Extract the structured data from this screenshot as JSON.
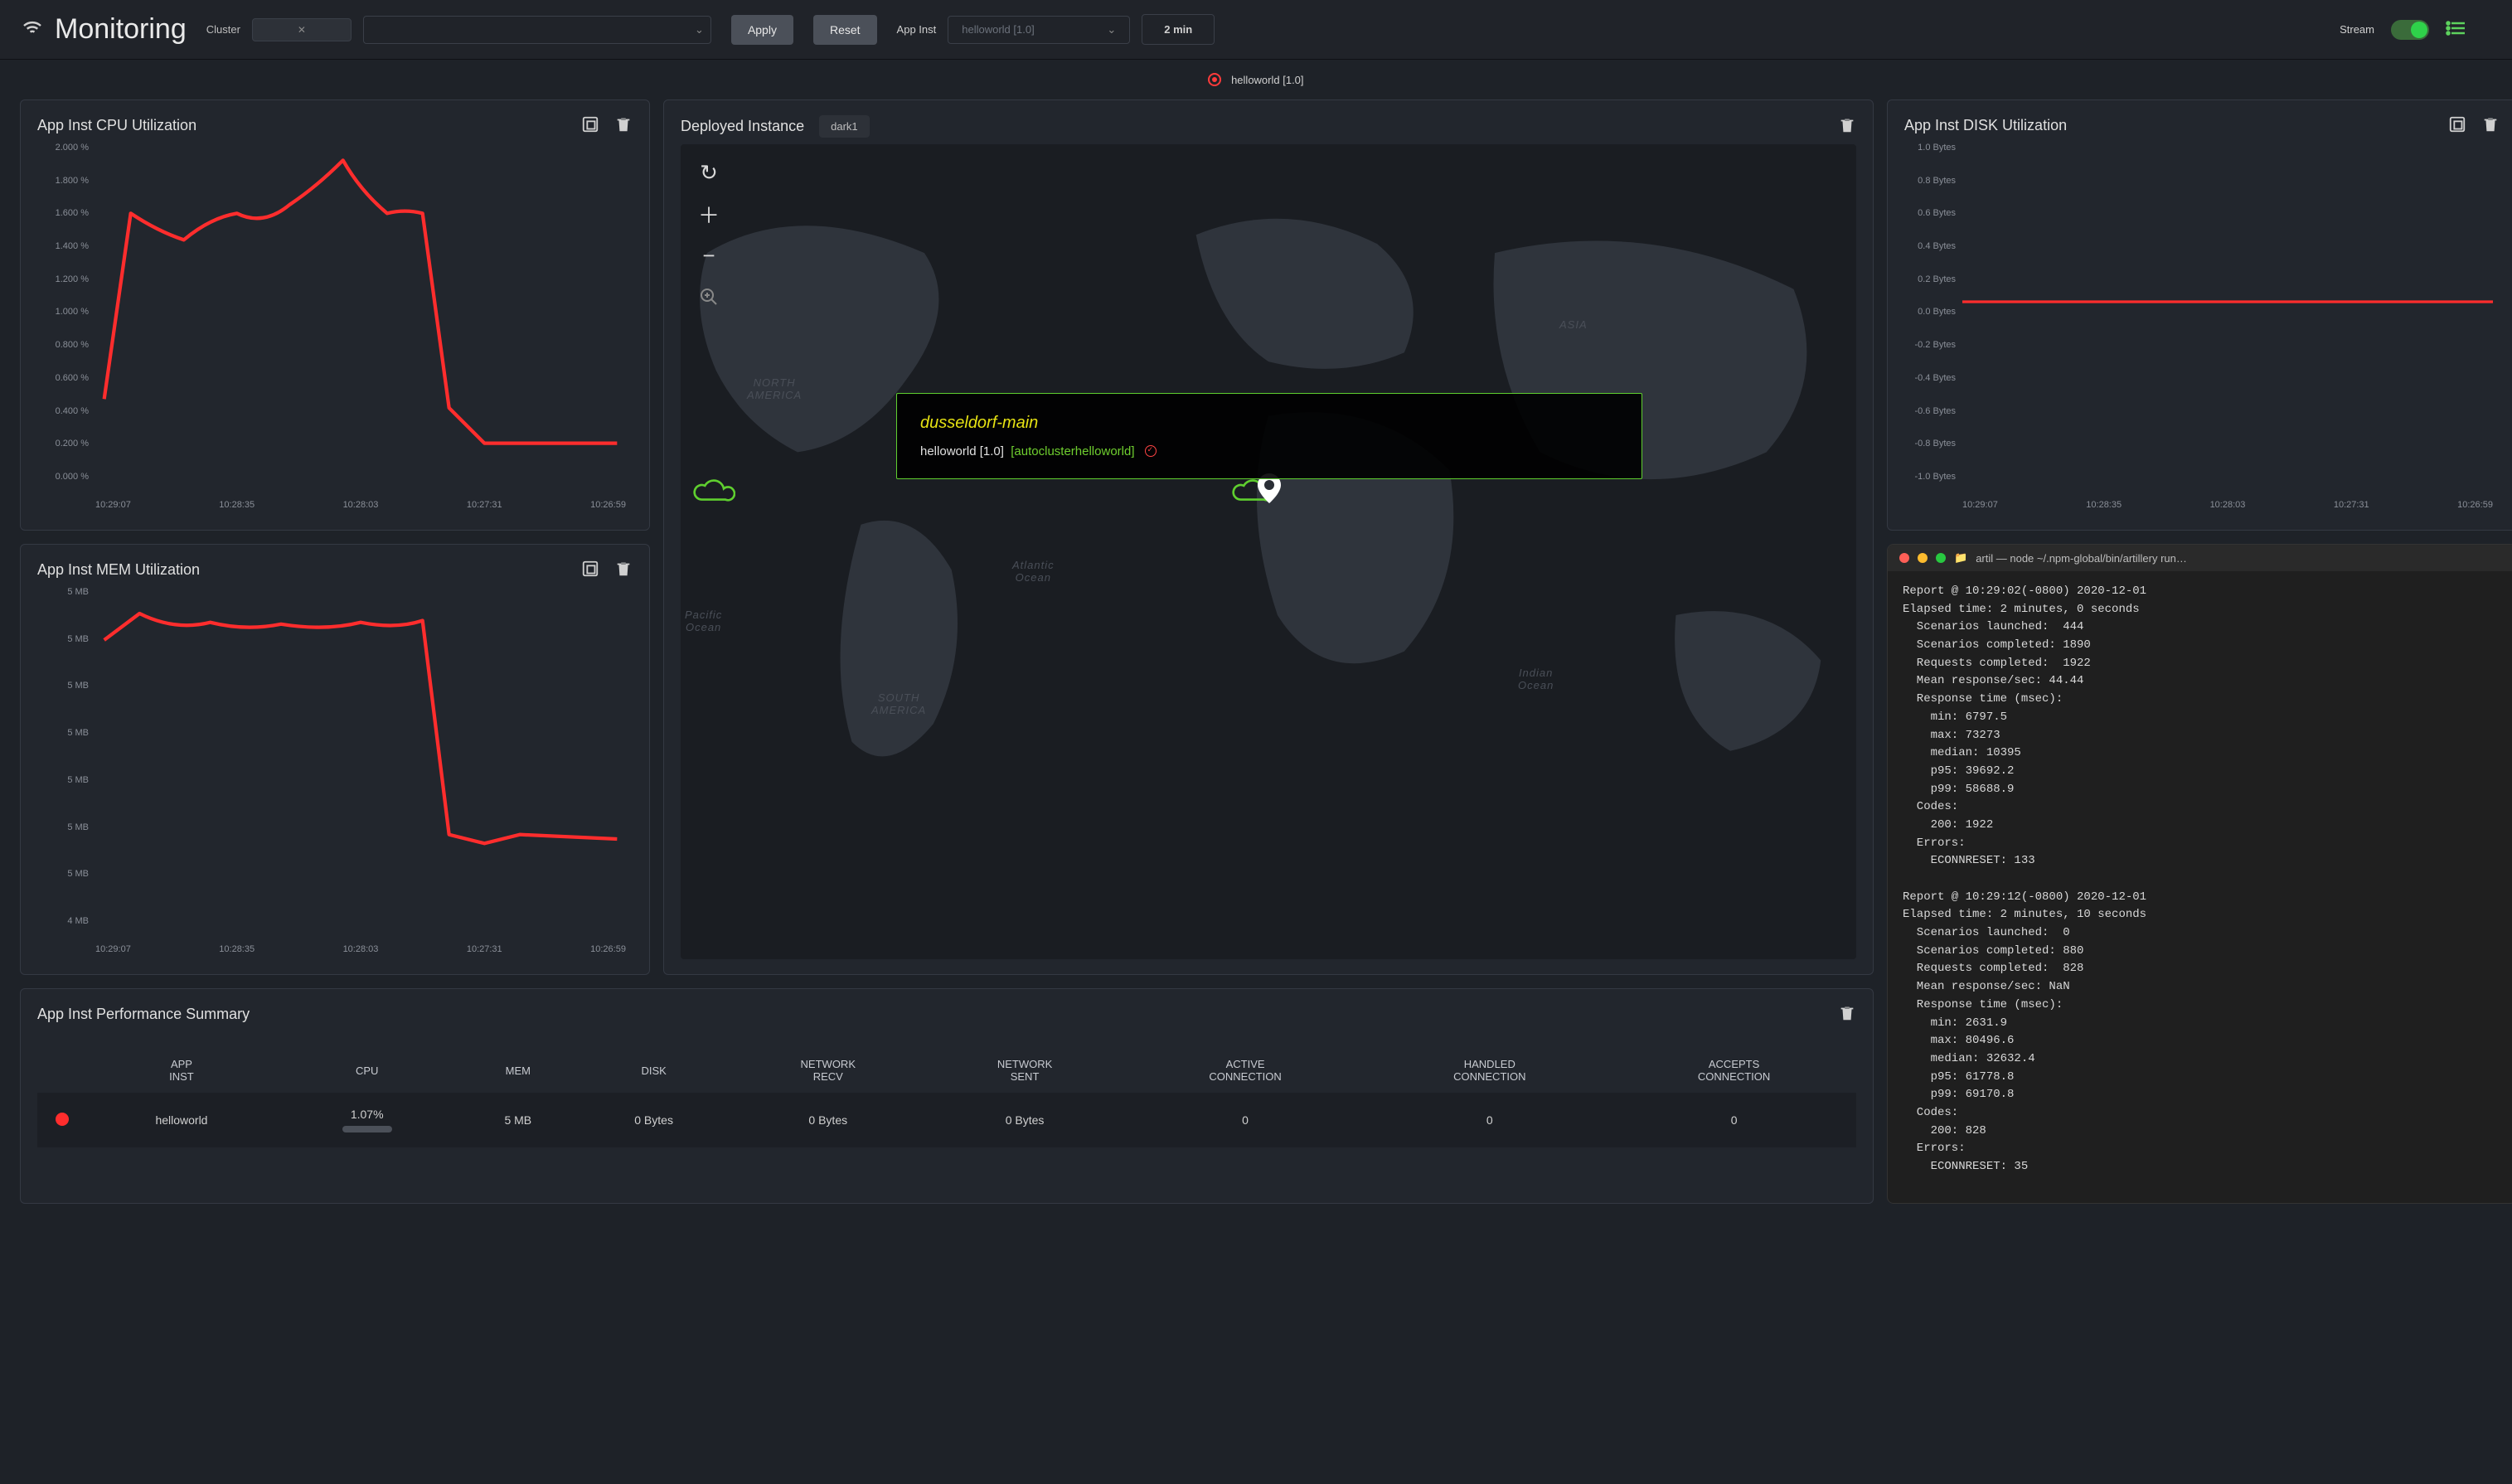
{
  "header": {
    "title": "Monitoring",
    "cluster_label": "Cluster",
    "cluster_value": "",
    "apply_label": "Apply",
    "reset_label": "Reset",
    "appinst_label": "App Inst",
    "appinst_placeholder": "helloworld [1.0]",
    "time_value": "2 min",
    "stream_label": "Stream"
  },
  "status_line": "helloworld [1.0]",
  "panels": {
    "cpu_title": "App Inst CPU Utilization",
    "mem_title": "App Inst MEM Utilization",
    "map_title": "Deployed Instance",
    "map_theme": "dark1",
    "disk_title": "App Inst DISK Utilization",
    "perf_title": "App Inst Performance Summary"
  },
  "map": {
    "tooltip_title": "dusseldorf-main",
    "tooltip_app": "helloworld [1.0]",
    "tooltip_cluster": "[autoclusterhelloworld]",
    "labels": {
      "na": "NORTH\nAMERICA",
      "sa": "SOUTH\nAMERICA",
      "asia": "ASIA",
      "atl": "Atlantic\nOcean",
      "pac": "Pacific\nOcean",
      "ind": "Indian\nOcean"
    }
  },
  "terminal": {
    "title": "artil — node ~/.npm-global/bin/artillery run…",
    "body": "Report @ 10:29:02(-0800) 2020-12-01\nElapsed time: 2 minutes, 0 seconds\n  Scenarios launched:  444\n  Scenarios completed: 1890\n  Requests completed:  1922\n  Mean response/sec: 44.44\n  Response time (msec):\n    min: 6797.5\n    max: 73273\n    median: 10395\n    p95: 39692.2\n    p99: 58688.9\n  Codes:\n    200: 1922\n  Errors:\n    ECONNRESET: 133\n\nReport @ 10:29:12(-0800) 2020-12-01\nElapsed time: 2 minutes, 10 seconds\n  Scenarios launched:  0\n  Scenarios completed: 880\n  Requests completed:  828\n  Mean response/sec: NaN\n  Response time (msec):\n    min: 2631.9\n    max: 80496.6\n    median: 32632.4\n    p95: 61778.8\n    p99: 69170.8\n  Codes:\n    200: 828\n  Errors:\n    ECONNRESET: 35"
  },
  "perf_table": {
    "headers": [
      "APP INST",
      "CPU",
      "MEM",
      "DISK",
      "NETWORK RECV",
      "NETWORK SENT",
      "ACTIVE CONNECTION",
      "HANDLED CONNECTION",
      "ACCEPTS CONNECTION"
    ],
    "row": {
      "app": "helloworld",
      "cpu": "1.07%",
      "mem": "5 MB",
      "disk": "0 Bytes",
      "nrecv": "0 Bytes",
      "nsent": "0 Bytes",
      "active": "0",
      "handled": "0",
      "accepts": "0"
    }
  },
  "chart_data": [
    {
      "id": "cpu",
      "type": "line",
      "title": "App Inst CPU Utilization",
      "ylabel": "%",
      "ylim": [
        0,
        2.0
      ],
      "y_ticks": [
        "2.000 %",
        "1.800 %",
        "1.600 %",
        "1.400 %",
        "1.200 %",
        "1.000 %",
        "0.800 %",
        "0.600 %",
        "0.400 %",
        "0.200 %",
        "0.000 %"
      ],
      "x_ticks": [
        "10:29:07",
        "10:28:35",
        "10:28:03",
        "10:27:31",
        "10:26:59"
      ],
      "x": [
        "10:29:07",
        "10:28:51",
        "10:28:35",
        "10:28:19",
        "10:28:03",
        "10:27:47",
        "10:27:31",
        "10:27:15",
        "10:26:59",
        "10:26:43"
      ],
      "values": [
        0.5,
        1.55,
        1.4,
        1.55,
        1.6,
        1.9,
        1.55,
        0.3,
        0.05,
        0.05
      ]
    },
    {
      "id": "mem",
      "type": "line",
      "title": "App Inst MEM Utilization",
      "ylabel": "MB",
      "ylim": [
        4.0,
        5.1
      ],
      "y_ticks": [
        "5 MB",
        "5 MB",
        "5 MB",
        "5 MB",
        "5 MB",
        "5 MB",
        "5 MB",
        "4 MB"
      ],
      "x_ticks": [
        "10:29:07",
        "10:28:35",
        "10:28:03",
        "10:27:31",
        "10:26:59"
      ],
      "x": [
        "10:29:07",
        "10:28:51",
        "10:28:35",
        "10:28:19",
        "10:28:03",
        "10:27:47",
        "10:27:31",
        "10:27:15",
        "10:26:59",
        "10:26:43"
      ],
      "values": [
        4.9,
        5.05,
        5.0,
        5.03,
        5.0,
        5.05,
        4.2,
        4.18,
        4.2,
        4.2
      ]
    },
    {
      "id": "disk",
      "type": "line",
      "title": "App Inst DISK Utilization",
      "ylabel": "Bytes",
      "ylim": [
        -1.0,
        1.0
      ],
      "y_ticks": [
        "1.0 Bytes",
        "0.8 Bytes",
        "0.6 Bytes",
        "0.4 Bytes",
        "0.2 Bytes",
        "0.0 Bytes",
        "-0.2 Bytes",
        "-0.4 Bytes",
        "-0.6 Bytes",
        "-0.8 Bytes",
        "-1.0 Bytes"
      ],
      "x_ticks": [
        "10:29:07",
        "10:28:35",
        "10:28:03",
        "10:27:31",
        "10:26:59"
      ],
      "x": [
        "10:29:07",
        "10:28:35",
        "10:28:03",
        "10:27:31",
        "10:26:59"
      ],
      "values": [
        0,
        0,
        0,
        0,
        0
      ]
    }
  ]
}
